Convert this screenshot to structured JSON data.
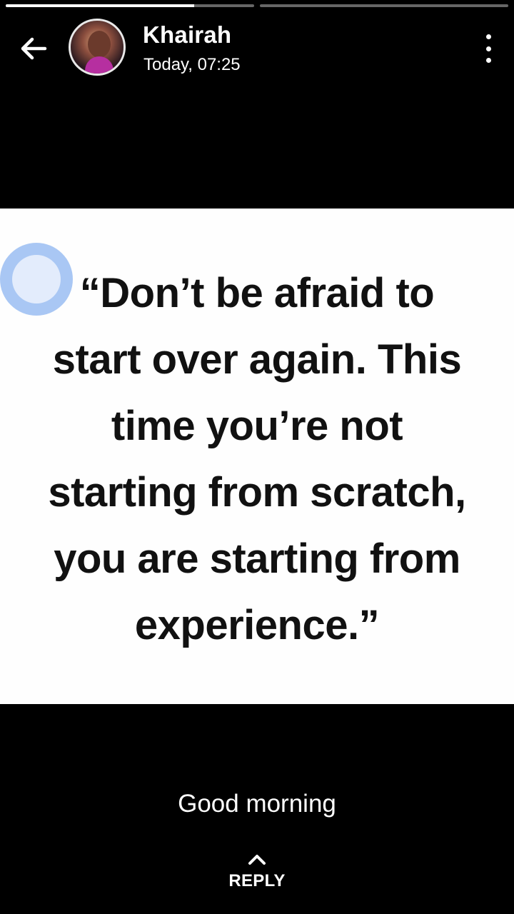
{
  "progress": {
    "segments": [
      {
        "fill_percent": 76
      },
      {
        "fill_percent": 0
      }
    ]
  },
  "header": {
    "contact_name": "Khairah",
    "timestamp": "Today, 07:25",
    "back_icon": "arrow-left-icon",
    "menu_icon": "more-vert-icon"
  },
  "status": {
    "quote_lines": [
      "“Don’t be afraid to",
      "start over again. This",
      "time you’re not",
      "starting from scratch,",
      "you are starting from",
      "experience.”"
    ],
    "caption": "Good morning"
  },
  "reply": {
    "label": "REPLY",
    "icon": "chevron-up-icon"
  },
  "colors": {
    "background": "#000000",
    "text": "#ffffff",
    "image_background": "#fefefe",
    "quote_text": "#111111",
    "touch_indicator": "#8cb4f0"
  }
}
